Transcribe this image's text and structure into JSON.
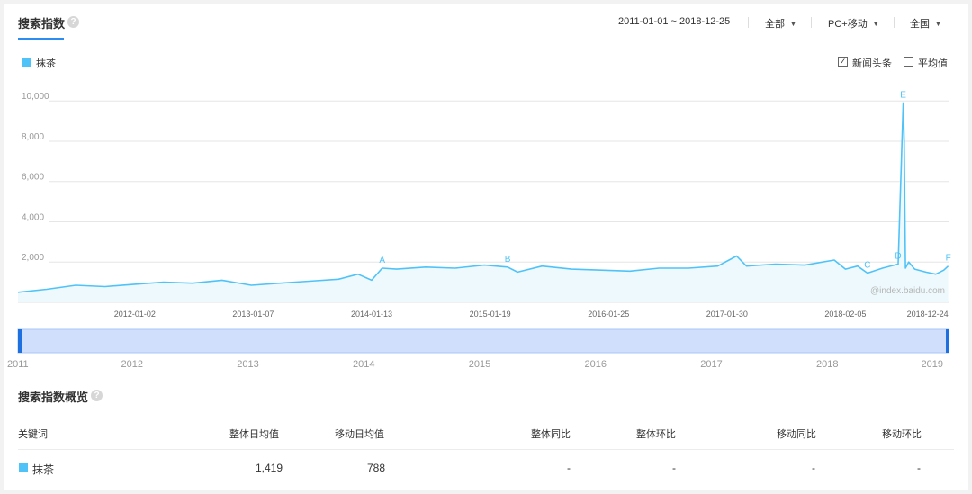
{
  "header": {
    "title": "搜索指数",
    "help": "?",
    "date_range": "2011-01-01 ~ 2018-12-25",
    "device_filter": "全部",
    "source_filter": "PC+移动",
    "region_filter": "全国",
    "caret": "▼"
  },
  "legend": {
    "keyword": "抹茶",
    "color": "#4fc3f7"
  },
  "options": {
    "news_label": "新闻头条",
    "news_checked": "✓",
    "avg_label": "平均值"
  },
  "chart_data": {
    "type": "area",
    "series": [
      {
        "name": "抹茶",
        "color": "#4fc3f7",
        "x": [
          "2011-01-01",
          "2011-04-01",
          "2011-07-01",
          "2011-10-01",
          "2012-01-01",
          "2012-04-01",
          "2012-07-01",
          "2012-10-01",
          "2013-01-01",
          "2013-04-01",
          "2013-07-01",
          "2013-10-01",
          "2013-12-01",
          "2014-01-13",
          "2014-02-15",
          "2014-04-01",
          "2014-07-01",
          "2014-10-01",
          "2015-01-01",
          "2015-03-15",
          "2015-04-15",
          "2015-07-01",
          "2015-10-01",
          "2016-01-01",
          "2016-04-01",
          "2016-07-01",
          "2016-10-01",
          "2017-01-01",
          "2017-03-01",
          "2017-04-01",
          "2017-07-01",
          "2017-10-01",
          "2018-01-01",
          "2018-02-05",
          "2018-03-15",
          "2018-04-15",
          "2018-06-01",
          "2018-07-20",
          "2018-08-05",
          "2018-08-08",
          "2018-08-12",
          "2018-08-22",
          "2018-09-10",
          "2018-10-15",
          "2018-11-15",
          "2018-12-10",
          "2018-12-24"
        ],
        "values": [
          500,
          650,
          850,
          780,
          900,
          1000,
          950,
          1100,
          850,
          950,
          1050,
          1150,
          1400,
          1100,
          1700,
          1650,
          1750,
          1700,
          1850,
          1750,
          1500,
          1800,
          1650,
          1600,
          1550,
          1700,
          1700,
          1800,
          2300,
          1800,
          1900,
          1850,
          2100,
          1650,
          1800,
          1450,
          1700,
          1900,
          9900,
          8000,
          1700,
          2000,
          1650,
          1500,
          1400,
          1600,
          1800
        ]
      }
    ],
    "annotations": [
      {
        "label": "A",
        "x": "2014-02-15"
      },
      {
        "label": "B",
        "x": "2015-03-15"
      },
      {
        "label": "C",
        "x": "2018-04-15"
      },
      {
        "label": "D",
        "x": "2018-07-20"
      },
      {
        "label": "E",
        "x": "2018-08-05"
      },
      {
        "label": "F",
        "x": "2018-12-24"
      }
    ],
    "y_ticks": [
      2000,
      4000,
      6000,
      8000,
      10000
    ],
    "y_tick_labels": [
      "2,000",
      "4,000",
      "6,000",
      "8,000",
      "10,000"
    ],
    "ylim": [
      0,
      10500
    ],
    "x_range": [
      "2011-01-01",
      "2018-12-25"
    ],
    "x_tick_dates": [
      "2012-01-02",
      "2013-01-07",
      "2014-01-13",
      "2015-01-19",
      "2016-01-25",
      "2017-01-30",
      "2018-02-05",
      "2018-12-24"
    ],
    "grid": true,
    "legend_position": "top-left",
    "watermark": "@index.baidu.com"
  },
  "range_slider": {
    "years": [
      "2011",
      "2012",
      "2013",
      "2014",
      "2015",
      "2016",
      "2017",
      "2018",
      "2019"
    ]
  },
  "overview": {
    "title": "搜索指数概览",
    "help": "?",
    "headers": {
      "keyword": "关键词",
      "overall_daily": "整体日均值",
      "mobile_daily": "移动日均值",
      "overall_yoy": "整体同比",
      "overall_mom": "整体环比",
      "mobile_yoy": "移动同比",
      "mobile_mom": "移动环比"
    },
    "row": {
      "keyword": "抹茶",
      "overall_daily": "1,419",
      "mobile_daily": "788",
      "overall_yoy": "-",
      "overall_mom": "-",
      "mobile_yoy": "-",
      "mobile_mom": "-"
    }
  }
}
